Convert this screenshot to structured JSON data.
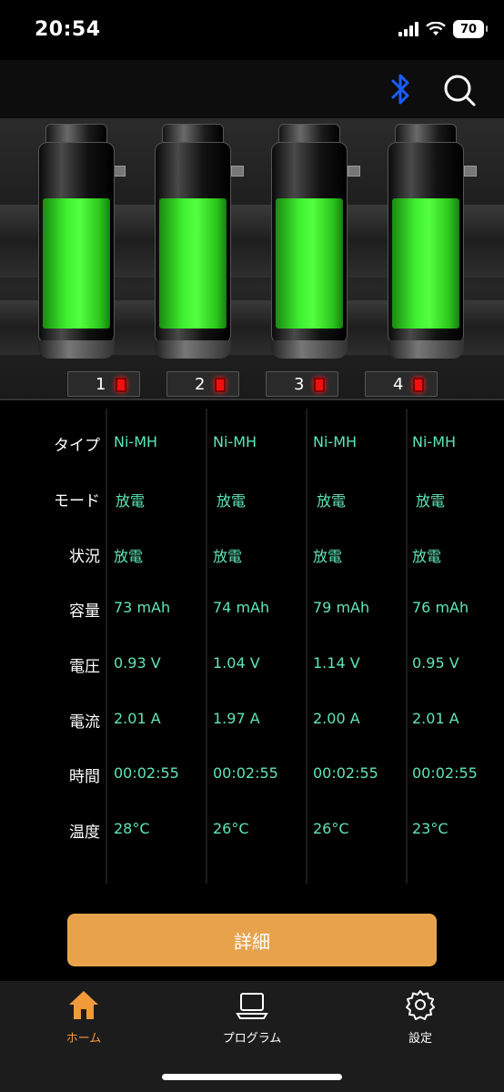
{
  "status_bar": {
    "time": "20:54",
    "battery": "70"
  },
  "channels": [
    {
      "slot": "1",
      "level": 0.76,
      "type": "Ni-MH",
      "mode": "放電",
      "state": "放電",
      "capacity": "73 mAh",
      "voltage": "0.93 V",
      "current": "2.01 A",
      "time": "00:02:55",
      "temp": "28°C"
    },
    {
      "slot": "2",
      "level": 0.76,
      "type": "Ni-MH",
      "mode": "放電",
      "state": "放電",
      "capacity": "74 mAh",
      "voltage": "1.04 V",
      "current": "1.97 A",
      "time": "00:02:55",
      "temp": "26°C"
    },
    {
      "slot": "3",
      "level": 0.76,
      "type": "Ni-MH",
      "mode": "放電",
      "state": "放電",
      "capacity": "79 mAh",
      "voltage": "1.14 V",
      "current": "2.00 A",
      "time": "00:02:55",
      "temp": "26°C"
    },
    {
      "slot": "4",
      "level": 0.76,
      "type": "Ni-MH",
      "mode": "放電",
      "state": "放電",
      "capacity": "76 mAh",
      "voltage": "0.95 V",
      "current": "2.01 A",
      "time": "00:02:55",
      "temp": "23°C"
    }
  ],
  "row_labels": {
    "type": "タイプ",
    "mode": "モード",
    "state": "状況",
    "capacity": "容量",
    "voltage": "電圧",
    "current": "電流",
    "time": "時間",
    "temp": "温度"
  },
  "details_button": "詳細",
  "tabs": [
    {
      "label": "ホーム",
      "icon": "home-icon",
      "active": true
    },
    {
      "label": "プログラム",
      "icon": "laptop-icon",
      "active": false
    },
    {
      "label": "設定",
      "icon": "gear-icon",
      "active": false
    }
  ],
  "colors": {
    "accent": "#e8a24c",
    "value_text": "#5fe6b6",
    "bluetooth": "#1a5cff",
    "battery_fill": "#3ff030",
    "led": "#f01010"
  }
}
